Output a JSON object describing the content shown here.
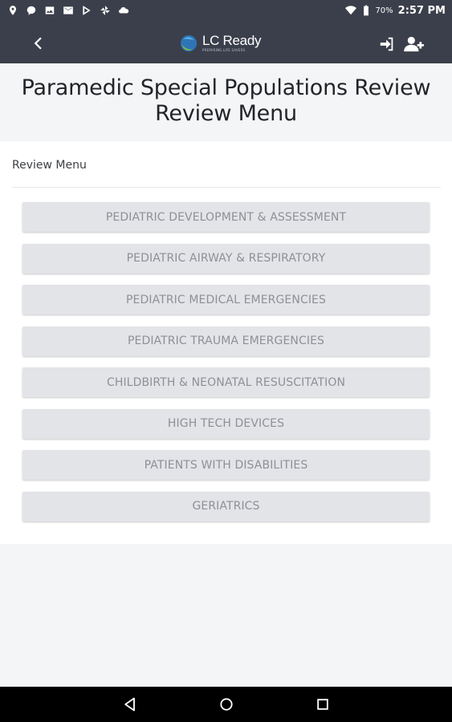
{
  "status_bar": {
    "battery_percent": "70%",
    "time": "2:57 PM",
    "left_icons": [
      "location-pin-icon",
      "chat-bubble-icon",
      "image-icon",
      "mail-icon",
      "play-store-icon",
      "pinwheel-icon",
      "cloud-icon"
    ],
    "right_icons": [
      "wifi-icon",
      "battery-icon"
    ]
  },
  "app_bar": {
    "logo_text": "LC Ready",
    "logo_tagline": "PREPARING LIFE SAVERS",
    "background": "#3b3f4b"
  },
  "page": {
    "title_line1": "Paramedic Special Populations Review",
    "title_line2": "Review Menu"
  },
  "menu": {
    "section_label": "Review Menu",
    "items": [
      {
        "label": "PEDIATRIC DEVELOPMENT & ASSESSMENT"
      },
      {
        "label": "PEDIATRIC AIRWAY & RESPIRATORY"
      },
      {
        "label": "PEDIATRIC MEDICAL EMERGENCIES"
      },
      {
        "label": "PEDIATRIC TRAUMA EMERGENCIES"
      },
      {
        "label": "CHILDBIRTH & NEONATAL RESUSCITATION"
      },
      {
        "label": "HIGH TECH DEVICES"
      },
      {
        "label": "PATIENTS WITH DISABILITIES"
      },
      {
        "label": "GERIATRICS"
      }
    ]
  },
  "nav_bar": {
    "buttons": [
      "back-triangle-icon",
      "home-circle-icon",
      "recents-square-icon"
    ]
  }
}
